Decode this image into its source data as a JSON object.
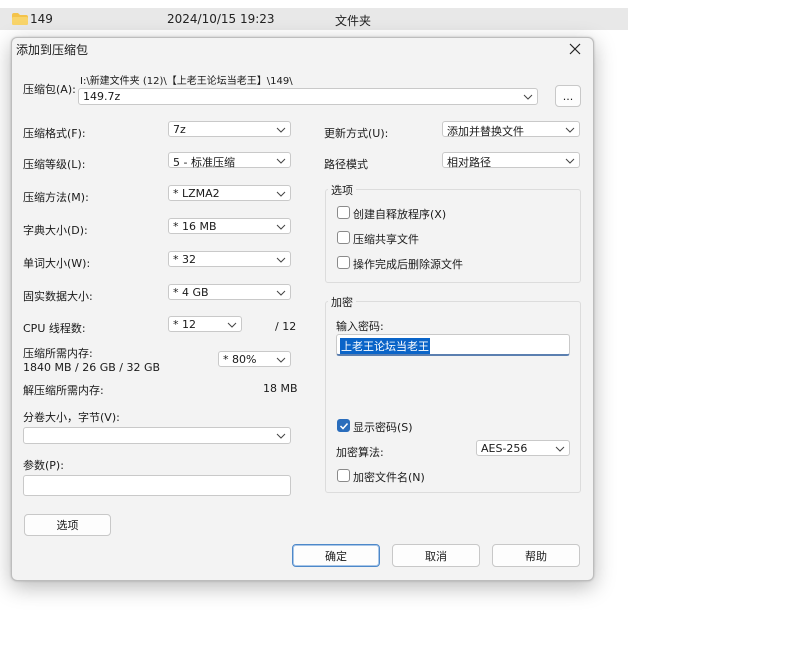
{
  "explorer": {
    "name": "149",
    "date": "2024/10/15 19:23",
    "type": "文件夹"
  },
  "dialog": {
    "title": "添加到压缩包",
    "archive": {
      "label": "压缩包(A):",
      "path": "I:\\新建文件夹 (12)\\【上老王论坛当老王】\\149\\",
      "name": "149.7z",
      "browse_label": "..."
    },
    "format": {
      "label": "压缩格式(F):",
      "value": "7z"
    },
    "level": {
      "label": "压缩等级(L):",
      "value": "5 - 标准压缩"
    },
    "method": {
      "label": "压缩方法(M):",
      "value": "* LZMA2"
    },
    "dict": {
      "label": "字典大小(D):",
      "value": "* 16 MB"
    },
    "word": {
      "label": "单词大小(W):",
      "value": "* 32"
    },
    "solid": {
      "label": "固实数据大小:",
      "value": "* 4 GB"
    },
    "threads": {
      "label": "CPU 线程数:",
      "value": "* 12",
      "max": "/ 12"
    },
    "memory": {
      "label": "压缩所需内存:",
      "detail": "1840 MB / 26 GB / 32 GB",
      "value": "* 80%"
    },
    "decomp_memory": {
      "label": "解压缩所需内存:",
      "value": "18 MB"
    },
    "split": {
      "label": "分卷大小，字节(V):",
      "value": ""
    },
    "params": {
      "label": "参数(P):",
      "value": ""
    },
    "options_button": "选项",
    "update": {
      "label": "更新方式(U):",
      "value": "添加并替换文件"
    },
    "path_mode": {
      "label": "路径模式",
      "value": "相对路径"
    },
    "options_group": {
      "title": "选项",
      "items": [
        {
          "label": "创建自释放程序(X)",
          "checked": false
        },
        {
          "label": "压缩共享文件",
          "checked": false
        },
        {
          "label": "操作完成后删除源文件",
          "checked": false
        }
      ]
    },
    "encryption": {
      "title": "加密",
      "password_label": "输入密码:",
      "password": "上老王论坛当老王",
      "show_password": {
        "label": "显示密码(S)",
        "checked": true
      },
      "method_label": "加密算法:",
      "method_value": "AES-256",
      "encrypt_names": {
        "label": "加密文件名(N)",
        "checked": false
      }
    },
    "buttons": {
      "ok": "确定",
      "cancel": "取消",
      "help": "帮助"
    }
  }
}
